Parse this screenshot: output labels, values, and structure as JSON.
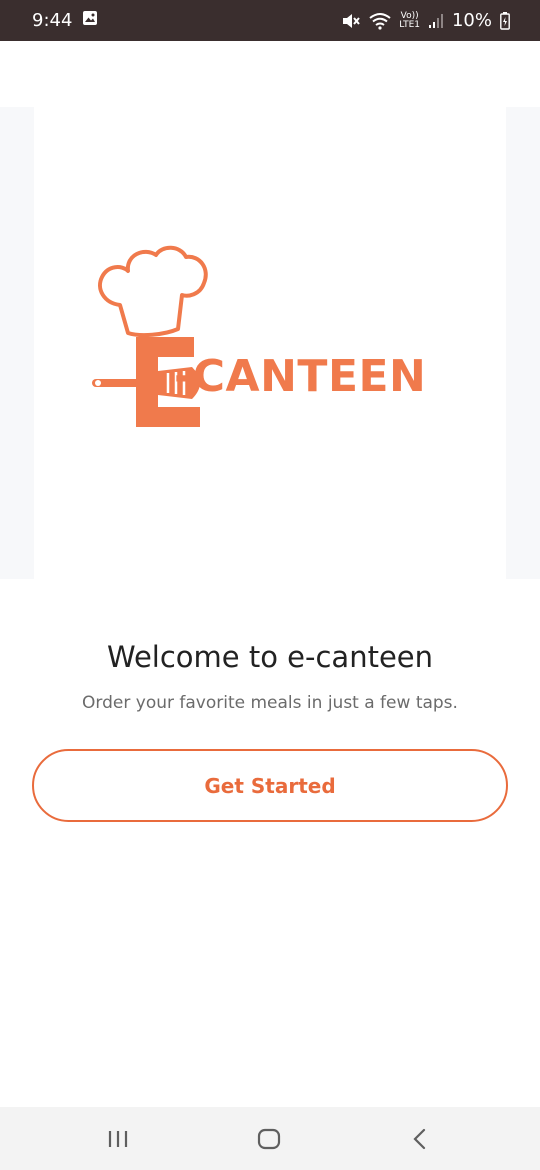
{
  "status_bar": {
    "time": "9:44",
    "network": "LTE1",
    "volte": "Vo))",
    "battery": "10%"
  },
  "hero": {
    "logo_text": "-CANTEEN",
    "accent_color": "#f07a4c"
  },
  "welcome": {
    "title": "Welcome to e-canteen",
    "subtitle": "Order your favorite meals in just a few taps."
  },
  "cta": {
    "label": "Get Started",
    "color": "#e96b3c"
  },
  "nav_bar": {
    "recents_icon": "recents-icon",
    "home_icon": "home-icon",
    "back_icon": "back-icon"
  }
}
